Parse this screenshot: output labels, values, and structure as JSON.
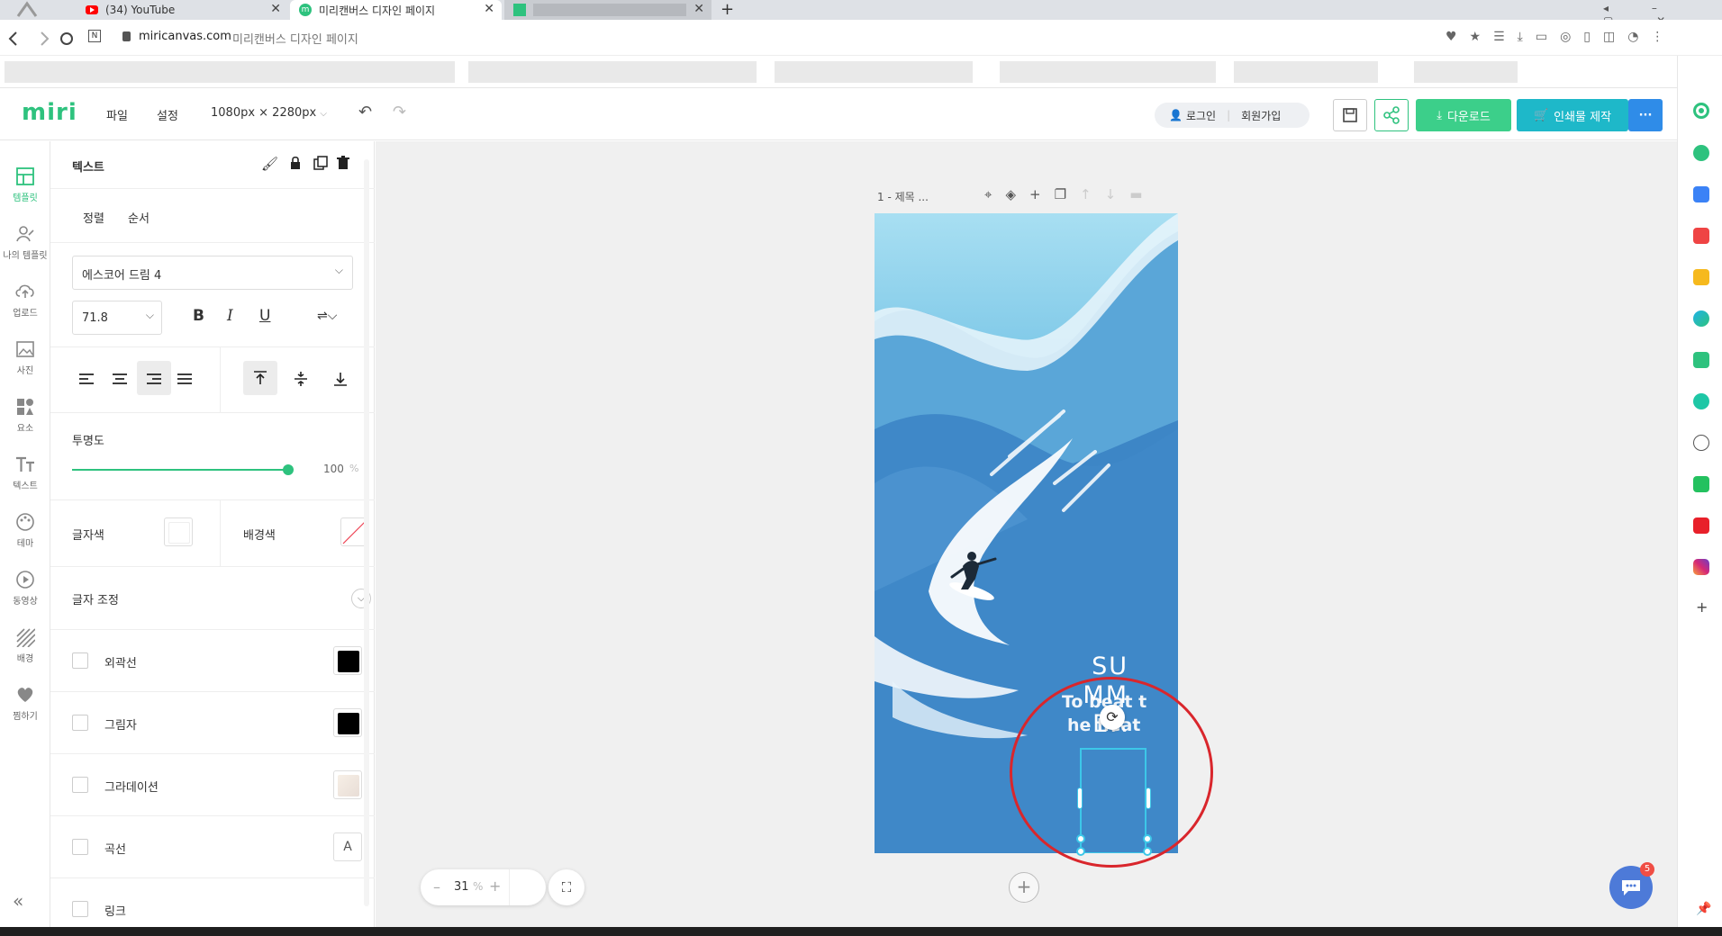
{
  "browser": {
    "tabs": [
      {
        "title": "(34) YouTube"
      },
      {
        "title": "미리캔버스 디자인 페이지"
      }
    ],
    "url_domain": "miricanvas.com",
    "url_title": "미리캔버스 디자인 페이지"
  },
  "header": {
    "logo": "miri",
    "menu_file": "파일",
    "menu_settings": "설정",
    "canvas_size": "1080px × 2280px",
    "login": "로그인",
    "signup": "회원가입",
    "download": "다운로드",
    "print": "인쇄물 제작",
    "more": "···"
  },
  "iconbar": [
    {
      "label": "템플릿",
      "icon": "template-icon"
    },
    {
      "label": "나의 템플릿",
      "icon": "my-template-icon"
    },
    {
      "label": "업로드",
      "icon": "upload-icon"
    },
    {
      "label": "사진",
      "icon": "photo-icon"
    },
    {
      "label": "요소",
      "icon": "elements-icon"
    },
    {
      "label": "텍스트",
      "icon": "text-icon"
    },
    {
      "label": "테마",
      "icon": "palette-icon"
    },
    {
      "label": "동영상",
      "icon": "video-icon"
    },
    {
      "label": "배경",
      "icon": "background-icon"
    },
    {
      "label": "찜하기",
      "icon": "heart-icon"
    }
  ],
  "panel": {
    "title": "텍스트",
    "tab_align": "정렬",
    "tab_order": "순서",
    "font": "에스코어 드림 4",
    "font_size": "71.8",
    "opacity_label": "투명도",
    "opacity_value": "100",
    "opacity_unit": "%",
    "opacity_level": 1.0,
    "text_color_label": "글자색",
    "bg_color_label": "배경색",
    "text_adjust_label": "글자 조정",
    "outline_label": "외곽선",
    "shadow_label": "그림자",
    "gradient_label": "그라데이션",
    "curve_label": "곡선",
    "link_label": "링크",
    "bold": "B",
    "italic": "I",
    "underline": "U"
  },
  "canvas": {
    "page_label": "1 - 제목 ...",
    "text_summer_1": "SU",
    "text_summer_2": "MM",
    "text_summer_3": "ER",
    "text_beat_1": "To beat t",
    "text_beat_2": "he heat",
    "zoom_value": "31",
    "zoom_unit": "%",
    "chat_badge": "5"
  },
  "colors": {
    "brand_green": "#2ec27e",
    "teal": "#1eb8c9",
    "blue": "#2f8ce8",
    "wave_blue": "#3d86c6",
    "annotation_red": "#d9262c"
  }
}
